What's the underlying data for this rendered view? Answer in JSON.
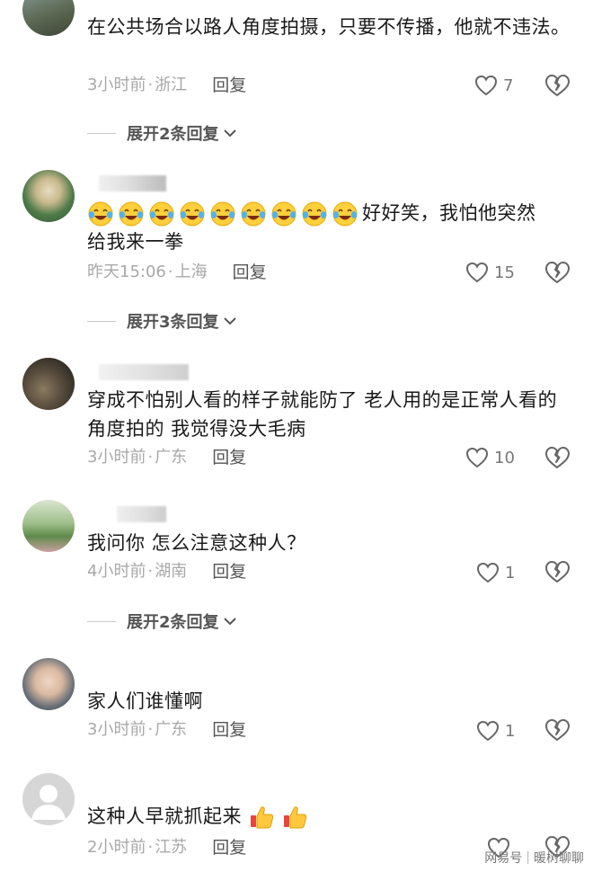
{
  "comments": [
    {
      "text": "在公共场合以路人角度拍摄，只要不传播，他就不违法。",
      "time": "3小时前",
      "location": "浙江",
      "reply_label": "回复",
      "likes": "7",
      "expand_label": "展开2条回复"
    },
    {
      "text": "好好笑，我怕他突然给我来一拳",
      "text_line1": "好好笑，我怕他突然",
      "text_line2": "给我来一拳",
      "emoji_count": 9,
      "time": "昨天15:06",
      "location": "上海",
      "reply_label": "回复",
      "likes": "15",
      "expand_label": "展开3条回复"
    },
    {
      "text": "穿成不怕别人看的样子就能防了 老人用的是正常人看的角度拍的 我觉得没大毛病",
      "time": "3小时前",
      "location": "广东",
      "reply_label": "回复",
      "likes": "10"
    },
    {
      "text": "我问你 怎么注意这种人？",
      "time": "4小时前",
      "location": "湖南",
      "reply_label": "回复",
      "likes": "1",
      "expand_label": "展开2条回复"
    },
    {
      "text": "家人们谁懂啊",
      "time": "3小时前",
      "location": "广东",
      "reply_label": "回复",
      "likes": "1"
    },
    {
      "text": "这种人早就抓起来",
      "time": "2小时前",
      "location": "江苏",
      "reply_label": "回复",
      "likes": ""
    }
  ],
  "meta_sep": "·",
  "watermark": {
    "left": "网易号",
    "right": "暖树聊聊"
  },
  "icons": {
    "like": "heart-outline-icon",
    "dislike": "broken-heart-icon",
    "expand": "chevron-down-icon"
  }
}
